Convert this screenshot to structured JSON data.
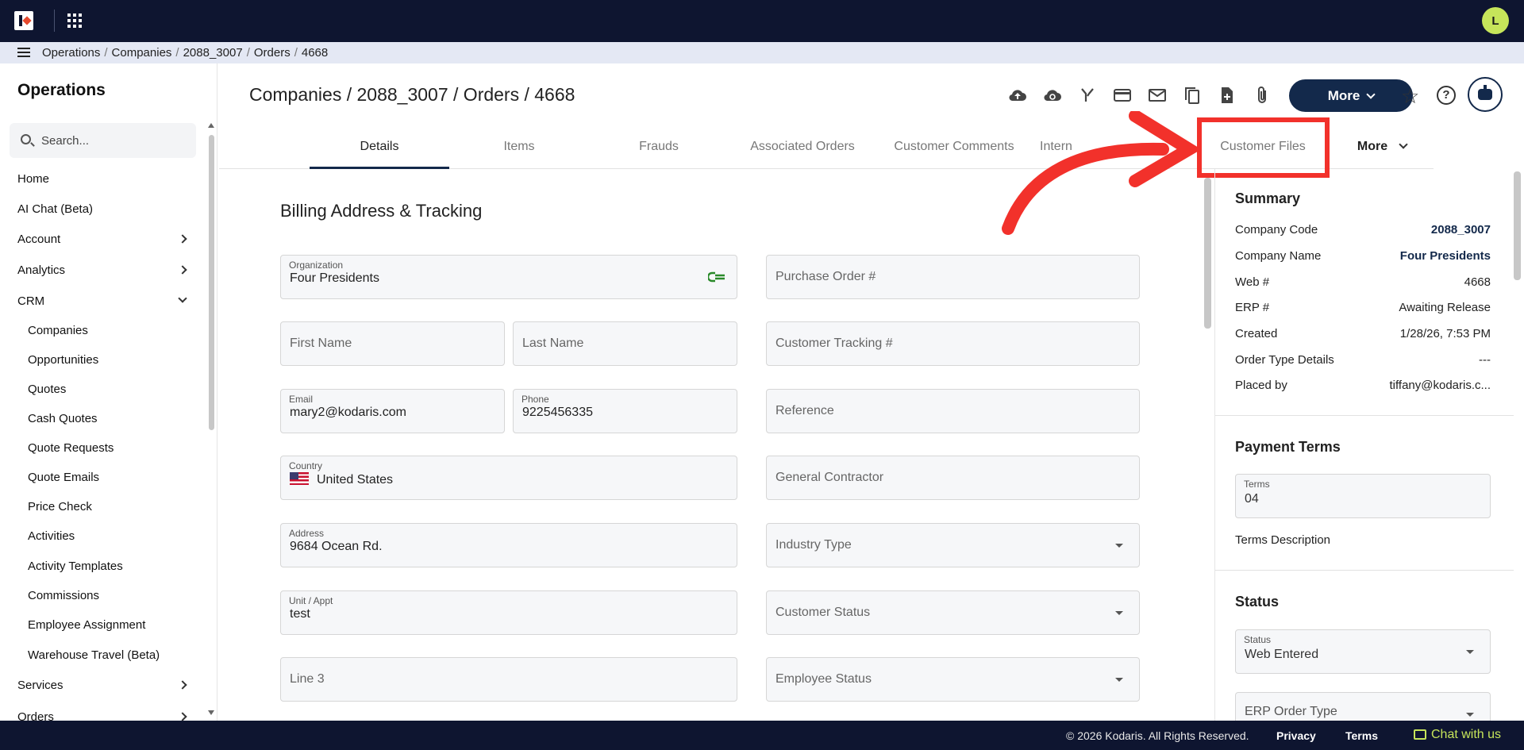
{
  "avatar_initial": "L",
  "breadcrumb": [
    "Operations",
    "Companies",
    "2088_3007",
    "Orders",
    "4668"
  ],
  "sidebar": {
    "title": "Operations",
    "search_placeholder": "Search...",
    "items": [
      {
        "label": "Home"
      },
      {
        "label": "AI Chat (Beta)"
      },
      {
        "label": "Account"
      },
      {
        "label": "Analytics"
      },
      {
        "label": "CRM"
      }
    ],
    "crm_subitems": [
      "Companies",
      "Opportunities",
      "Quotes",
      "Cash Quotes",
      "Quote Requests",
      "Quote Emails",
      "Price Check",
      "Activities",
      "Activity Templates",
      "Commissions",
      "Employee Assignment",
      "Warehouse Travel (Beta)"
    ],
    "bottom_items": [
      {
        "label": "Services"
      },
      {
        "label": "Orders"
      }
    ]
  },
  "page": {
    "title": "Companies / 2088_3007 / Orders / 4668",
    "more_label": "More"
  },
  "tabs": [
    "Details",
    "Items",
    "Frauds",
    "Associated Orders",
    "Customer Comments",
    "Intern",
    "Customer Files",
    "More"
  ],
  "form": {
    "section_title": "Billing Address & Tracking",
    "organization": {
      "label": "Organization",
      "value": "Four Presidents"
    },
    "purchase_order": {
      "placeholder": "Purchase Order #"
    },
    "first_name": {
      "placeholder": "First Name"
    },
    "last_name": {
      "placeholder": "Last Name"
    },
    "customer_tracking": {
      "placeholder": "Customer Tracking #"
    },
    "email": {
      "label": "Email",
      "value": "mary2@kodaris.com"
    },
    "phone": {
      "label": "Phone",
      "value": "9225456335"
    },
    "reference": {
      "placeholder": "Reference"
    },
    "country": {
      "label": "Country",
      "value": "United States"
    },
    "general_contractor": {
      "placeholder": "General Contractor"
    },
    "address": {
      "label": "Address",
      "value": "9684 Ocean Rd."
    },
    "industry_type": {
      "placeholder": "Industry Type"
    },
    "unit": {
      "label": "Unit / Appt",
      "value": "test"
    },
    "customer_status": {
      "placeholder": "Customer Status"
    },
    "line3": {
      "placeholder": "Line 3"
    },
    "employee_status": {
      "placeholder": "Employee Status"
    }
  },
  "summary": {
    "title": "Summary",
    "rows": [
      {
        "k": "Company Code",
        "v": "2088_3007"
      },
      {
        "k": "Company Name",
        "v": "Four Presidents"
      },
      {
        "k": "Web #",
        "v": "4668"
      },
      {
        "k": "ERP #",
        "v": "Awaiting Release"
      },
      {
        "k": "Created",
        "v": "1/28/26, 7:53 PM"
      },
      {
        "k": "Order Type Details",
        "v": "---"
      },
      {
        "k": "Placed by",
        "v": "tiffany@kodaris.c..."
      }
    ]
  },
  "payment_terms": {
    "title": "Payment Terms",
    "terms_label": "Terms",
    "terms_value": "04",
    "description_label": "Terms Description"
  },
  "status": {
    "title": "Status",
    "status_label": "Status",
    "status_value": "Web Entered",
    "erp_order_type": "ERP Order Type"
  },
  "footer": {
    "copyright": "© 2026 Kodaris. All Rights Reserved.",
    "privacy": "Privacy",
    "terms": "Terms",
    "chat": "Chat with us"
  },
  "colors": {
    "navy": "#0e1530",
    "accent": "#13294b",
    "highlight": "#f2312b",
    "lime": "#c6e55a"
  }
}
